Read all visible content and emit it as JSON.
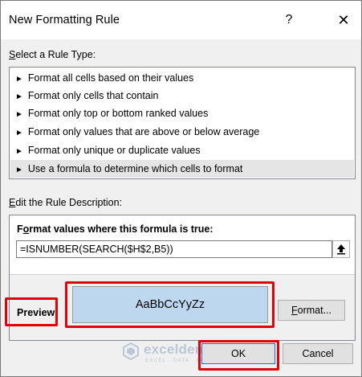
{
  "window": {
    "title": "New Formatting Rule",
    "help_glyph": "?",
    "close_glyph": "✕"
  },
  "rule_type": {
    "heading": "Select a Rule Type:",
    "items": [
      {
        "label": "Format all cells based on their values",
        "selected": false
      },
      {
        "label": "Format only cells that contain",
        "selected": false
      },
      {
        "label": "Format only top or bottom ranked values",
        "selected": false
      },
      {
        "label": "Format only values that are above or below average",
        "selected": false
      },
      {
        "label": "Format only unique or duplicate values",
        "selected": false
      },
      {
        "label": "Use a formula to determine which cells to format",
        "selected": true
      }
    ],
    "bullet": "►"
  },
  "description": {
    "heading": "Edit the Rule Description:",
    "formula_label": "Format values where this formula is true:",
    "formula_value": "=ISNUMBER(SEARCH($H$2,B5))",
    "preview_label": "Preview:",
    "preview_text": "AaBbCcYyZz",
    "preview_fill": "#bdd7ee",
    "format_button": "Format..."
  },
  "buttons": {
    "ok": "OK",
    "cancel": "Cancel"
  },
  "highlight_color": "#e0000b",
  "watermark": {
    "name": "exceldemy",
    "tagline": "EXCEL · DATA · BI"
  }
}
